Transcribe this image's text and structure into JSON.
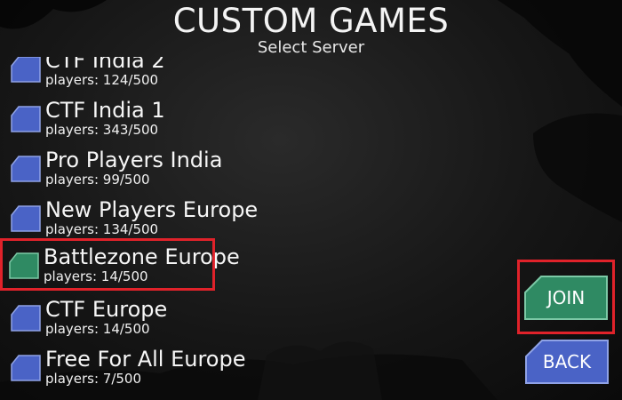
{
  "header": {
    "title": "CUSTOM GAMES",
    "subtitle": "Select Server"
  },
  "servers": [
    {
      "name": "CTF India 2",
      "players": "players: 124/500",
      "selected": false
    },
    {
      "name": "CTF India 1",
      "players": "players: 343/500",
      "selected": false
    },
    {
      "name": "Pro Players India",
      "players": "players: 99/500",
      "selected": false
    },
    {
      "name": "New Players Europe",
      "players": "players: 134/500",
      "selected": false
    },
    {
      "name": "Battlezone Europe",
      "players": "players: 14/500",
      "selected": true
    },
    {
      "name": "CTF Europe",
      "players": "players: 14/500",
      "selected": false
    },
    {
      "name": "Free For All Europe",
      "players": "players: 7/500",
      "selected": false
    }
  ],
  "buttons": {
    "join_label": "JOIN",
    "back_label": "BACK"
  },
  "colors": {
    "server_icon_blue": "#4a63c6",
    "server_icon_selected": "#2f8a63",
    "highlight_red": "#e0222a",
    "join_green": "#2f8a63",
    "back_blue": "#4a63c6"
  }
}
